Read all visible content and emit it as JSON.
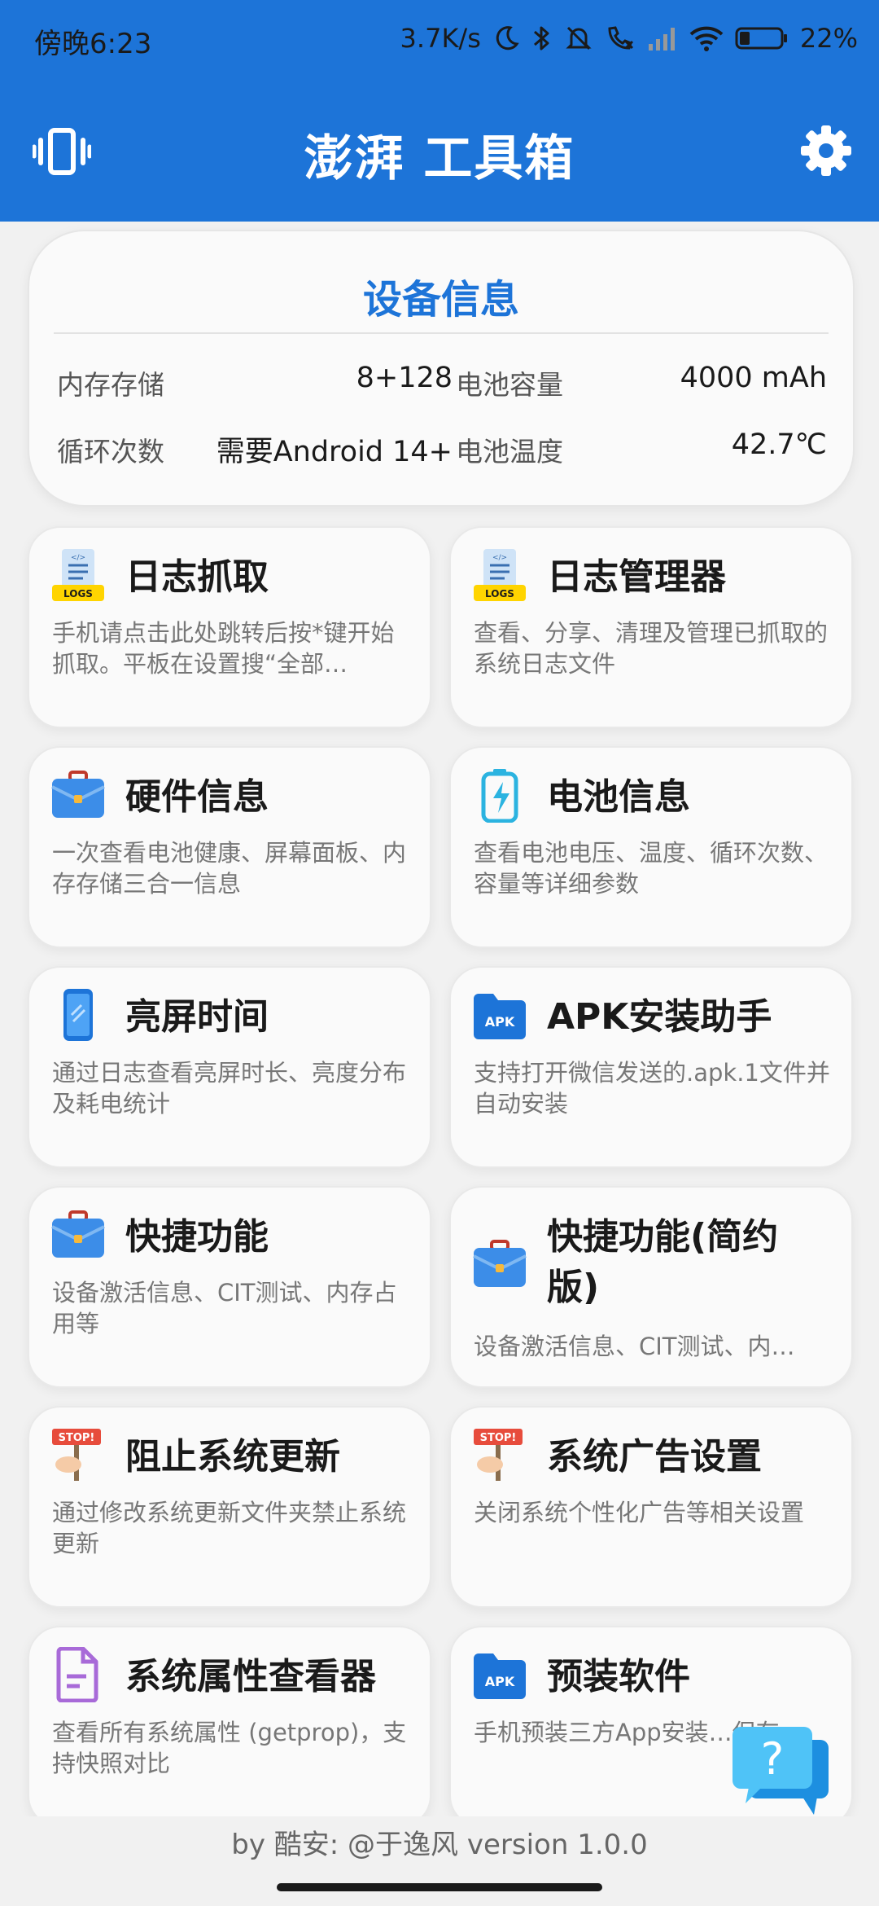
{
  "status_bar": {
    "time": "傍晚6:23",
    "net_speed": "3.7K/s",
    "battery": "22%"
  },
  "header": {
    "title": "澎湃 工具箱",
    "left_icon": "vibrate-icon",
    "right_icon": "gear-icon"
  },
  "device_info": {
    "title": "设备信息",
    "storage_label": "内存存储",
    "storage_value": "8+128",
    "battery_capacity_label": "电池容量",
    "battery_capacity_value": "4000 mAh",
    "cycle_label": "循环次数",
    "cycle_value": "需要Android 14+",
    "battery_temp_label": "电池温度",
    "battery_temp_value": "42.7℃"
  },
  "tiles": [
    {
      "title": "日志抓取",
      "desc": "手机请点击此处跳转后按*键开始抓取。平板在设置搜“全部…",
      "icon": "logs-icon"
    },
    {
      "title": "日志管理器",
      "desc": "查看、分享、清理及管理已抓取的系统日志文件",
      "icon": "logs-icon"
    },
    {
      "title": "硬件信息",
      "desc": "一次查看电池健康、屏幕面板、内存存储三合一信息",
      "icon": "briefcase-icon"
    },
    {
      "title": "电池信息",
      "desc": "查看电池电压、温度、循环次数、容量等详细参数",
      "icon": "battery-icon"
    },
    {
      "title": "亮屏时间",
      "desc": "通过日志查看亮屏时长、亮度分布及耗电统计",
      "icon": "phone-icon"
    },
    {
      "title": "APK安装助手",
      "desc": "支持打开微信发送的.apk.1文件并自动安装",
      "icon": "apk-folder-icon"
    },
    {
      "title": "快捷功能",
      "desc": "设备激活信息、CIT测试、内存占用等",
      "icon": "briefcase-icon"
    },
    {
      "title": "快捷功能(简约版)",
      "desc": "设备激活信息、CIT测试、内…",
      "icon": "briefcase-icon"
    },
    {
      "title": "阻止系统更新",
      "desc": "通过修改系统更新文件夹禁止系统更新",
      "icon": "stop-sign-icon"
    },
    {
      "title": "系统广告设置",
      "desc": "关闭系统个性化广告等相关设置",
      "icon": "stop-sign-icon"
    },
    {
      "title": "系统属性查看器",
      "desc": "查看所有系统属性 (getprop)，支持快照对比",
      "icon": "document-icon"
    },
    {
      "title": "预装软件",
      "desc": "手机预装三方App安装…保存",
      "icon": "apk-folder-icon"
    }
  ],
  "footer": {
    "text": "by 酷安: @于逸风 version 1.0.0"
  },
  "fab": {
    "icon": "help-chat-icon"
  }
}
